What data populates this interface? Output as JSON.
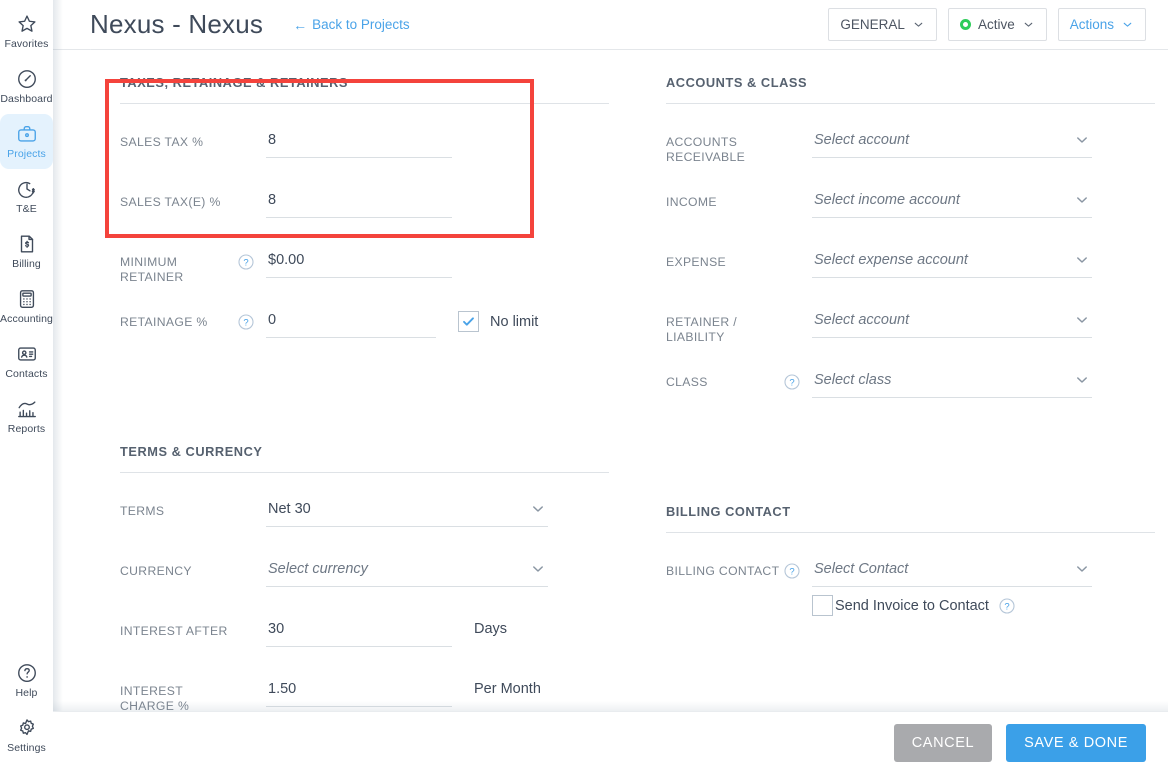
{
  "sidebar": {
    "items": [
      {
        "label": "Favorites",
        "icon": "star-icon",
        "active": false
      },
      {
        "label": "Dashboard",
        "icon": "gauge-icon",
        "active": false
      },
      {
        "label": "Projects",
        "icon": "briefcase-icon",
        "active": true
      },
      {
        "label": "T&E",
        "icon": "clock-dollar-icon",
        "active": false
      },
      {
        "label": "Billing",
        "icon": "invoice-dollar-icon",
        "active": false
      },
      {
        "label": "Accounting",
        "icon": "calculator-icon",
        "active": false
      },
      {
        "label": "Contacts",
        "icon": "contact-card-icon",
        "active": false
      },
      {
        "label": "Reports",
        "icon": "bar-chart-icon",
        "active": false
      }
    ],
    "bottom_items": [
      {
        "label": "Help",
        "icon": "question-circle-icon"
      },
      {
        "label": "Settings",
        "icon": "gear-icon"
      }
    ]
  },
  "topbar": {
    "title": "Nexus - Nexus",
    "back_link": "Back to Projects",
    "back_arrow": "←",
    "general_button": "GENERAL",
    "status_button": "Active",
    "status_color": "#2ecc5a",
    "actions_button": "Actions"
  },
  "sections": {
    "taxes": {
      "title": "TAXES, RETAINAGE & RETAINERS",
      "fields": {
        "sales_tax": {
          "label": "SALES TAX %",
          "value": "8"
        },
        "sales_tax_e": {
          "label": "SALES TAX(E) %",
          "value": "8"
        },
        "minimum_retainer": {
          "label": "MINIMUM RETAINER",
          "value": "$0.00"
        },
        "retainage": {
          "label": "RETAINAGE %",
          "value": "0",
          "checkbox_label": "No limit",
          "checked": true
        }
      }
    },
    "accounts": {
      "title": "ACCOUNTS & CLASS",
      "fields": {
        "accounts_receivable": {
          "label": "ACCOUNTS RECEIVABLE",
          "placeholder": "Select account"
        },
        "income": {
          "label": "INCOME",
          "placeholder": "Select income account"
        },
        "expense": {
          "label": "EXPENSE",
          "placeholder": "Select expense account"
        },
        "retainer_liability": {
          "label": "RETAINER / LIABILITY",
          "placeholder": "Select account"
        },
        "class": {
          "label": "CLASS",
          "placeholder": "Select class"
        }
      }
    },
    "terms": {
      "title": "TERMS & CURRENCY",
      "fields": {
        "terms": {
          "label": "TERMS",
          "value": "Net 30"
        },
        "currency": {
          "label": "CURRENCY",
          "placeholder": "Select currency"
        },
        "interest_after": {
          "label": "INTEREST AFTER",
          "value": "30",
          "suffix": "Days"
        },
        "interest_charge": {
          "label": "INTEREST CHARGE %",
          "value": "1.50",
          "suffix": "Per Month"
        }
      }
    },
    "billing_contact": {
      "title": "BILLING CONTACT",
      "fields": {
        "billing_contact": {
          "label": "BILLING CONTACT",
          "placeholder": "Select Contact"
        },
        "send_invoice": {
          "checkbox_label": "Send Invoice to Contact",
          "checked": false
        }
      }
    }
  },
  "footer": {
    "cancel_label": "CANCEL",
    "save_label": "SAVE & DONE"
  },
  "annotation": {
    "highlight_color": "#f4433c"
  }
}
